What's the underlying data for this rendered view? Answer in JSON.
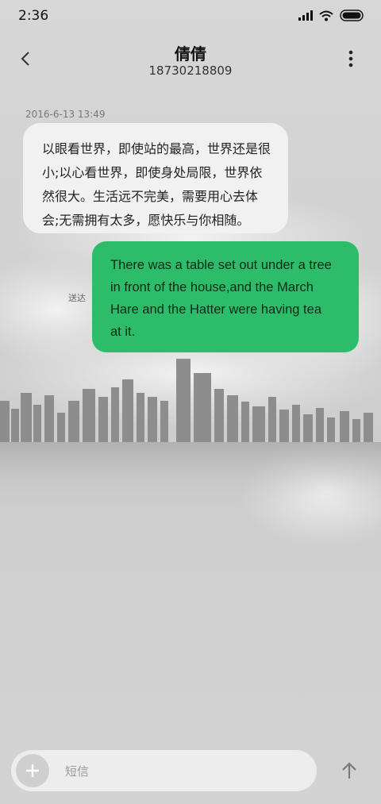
{
  "status_bar": {
    "time": "2:36",
    "icons": [
      "signal-icon",
      "wifi-icon",
      "battery-icon"
    ]
  },
  "header": {
    "back_icon": "chevron-left-icon",
    "contact_name": "倩倩",
    "contact_number": "18730218809",
    "more_icon": "more-vertical-icon"
  },
  "conversation": {
    "timestamp": "2016-6-13 13:49",
    "messages": [
      {
        "direction": "incoming",
        "lines": [
          "以眼看世界，即使站的最高，世界还是很",
          "小;以心看世界，即使身处局限，世界依",
          "然很大。生活远不完美，需要用心去体",
          "会;无需拥有太多，愿快乐与你相随。"
        ]
      },
      {
        "direction": "outgoing",
        "lines": [
          "There was a table set out under a tree",
          "in front of the house,and the March",
          "Hare and the Hatter were having tea",
          "at it."
        ],
        "status": "送达"
      }
    ]
  },
  "composer": {
    "add_icon": "plus-icon",
    "placeholder": "短信",
    "value": "",
    "send_icon": "arrow-up-icon"
  },
  "colors": {
    "outgoing_bubble": "#2dbd6a",
    "incoming_bubble": "#f1f1f1",
    "background": "#d3d3d3"
  }
}
